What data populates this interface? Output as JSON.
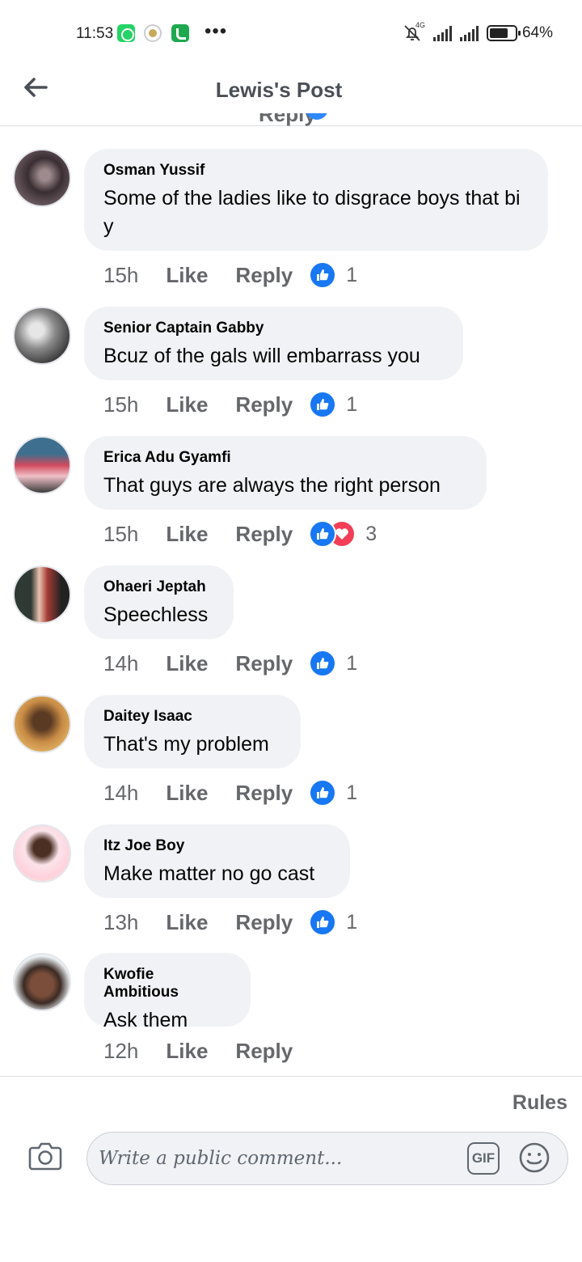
{
  "status_bar": {
    "time": "11:53",
    "more": "•••",
    "network": "4G",
    "battery": "64%"
  },
  "header": {
    "title": "Lewis's Post",
    "back_icon": "arrow-left-icon"
  },
  "clipped_comment": {
    "reply_label": "Reply"
  },
  "comments": [
    {
      "author": "Osman Yussif",
      "text": "Some of the ladies like to disgrace boys that bi y",
      "time": "15h",
      "like": "Like",
      "reply": "Reply",
      "reactions": [
        "like"
      ],
      "count": "1"
    },
    {
      "author": "Senior Captain Gabby",
      "text": "Bcuz of the gals will embarrass you",
      "time": "15h",
      "like": "Like",
      "reply": "Reply",
      "reactions": [
        "like"
      ],
      "count": "1"
    },
    {
      "author": "Erica Adu Gyamfi",
      "text": "That guys are always the right person",
      "time": "15h",
      "like": "Like",
      "reply": "Reply",
      "reactions": [
        "like",
        "love"
      ],
      "count": "3"
    },
    {
      "author": "Ohaeri Jeptah",
      "text": "Speechless",
      "time": "14h",
      "like": "Like",
      "reply": "Reply",
      "reactions": [
        "like"
      ],
      "count": "1"
    },
    {
      "author": "Daitey Isaac",
      "text": "That's my problem",
      "time": "14h",
      "like": "Like",
      "reply": "Reply",
      "reactions": [
        "like"
      ],
      "count": "1"
    },
    {
      "author": "Itz Joe Boy",
      "text": "Make matter no go cast",
      "time": "13h",
      "like": "Like",
      "reply": "Reply",
      "reactions": [
        "like"
      ],
      "count": "1"
    },
    {
      "author": "Kwofie Ambitious",
      "text": "Ask them",
      "time": "12h",
      "like": "Like",
      "reply": "Reply",
      "reactions": [],
      "count": ""
    }
  ],
  "composer": {
    "rules": "Rules",
    "placeholder": "Write a public comment...",
    "gif": "GIF",
    "camera_icon": "camera-icon",
    "emoji_icon": "emoji-icon"
  },
  "colors": {
    "bubble": "#f0f2f5",
    "like_blue": "#1877f2",
    "love_red": "#f33e58",
    "muted_text": "#65676b"
  }
}
